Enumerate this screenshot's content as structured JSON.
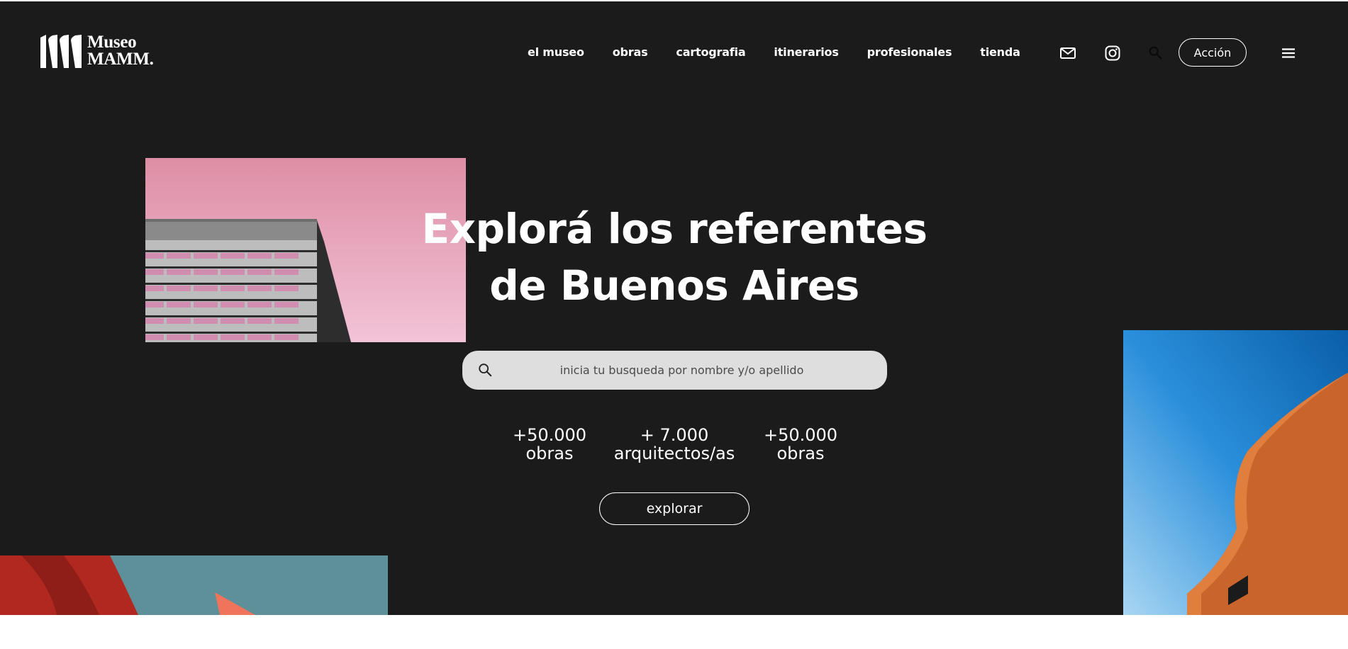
{
  "brand": {
    "line1": "Museo",
    "line2": "MAMM."
  },
  "nav": [
    {
      "label": "el museo"
    },
    {
      "label": "obras"
    },
    {
      "label": "cartografia"
    },
    {
      "label": "itinerarios"
    },
    {
      "label": "profesionales"
    },
    {
      "label": "tienda"
    }
  ],
  "header": {
    "action_label": "Acción",
    "icons": [
      "mail-icon",
      "instagram-icon",
      "search-icon",
      "menu-icon"
    ]
  },
  "hero": {
    "title_line1": "Explorá los referentes",
    "title_line2": "de Buenos Aires",
    "search_placeholder": "inicia tu busqueda por nombre y/o apellido"
  },
  "stats": [
    {
      "value": "+50.000",
      "label": "obras"
    },
    {
      "value": "+ 7.000",
      "label": "arquitectos/as"
    },
    {
      "value": "+50.000",
      "label": "obras"
    }
  ],
  "cta": {
    "label": "explorar"
  },
  "colors": {
    "background": "#1b1b1b",
    "text": "#ffffff",
    "search_bg": "#dedede",
    "pink_sky": "#e497ad",
    "blue_sky": "#1e86d6",
    "brick": "#c9652c",
    "teal_sky": "#5e9099",
    "red_sculpture": "#b0281f"
  }
}
